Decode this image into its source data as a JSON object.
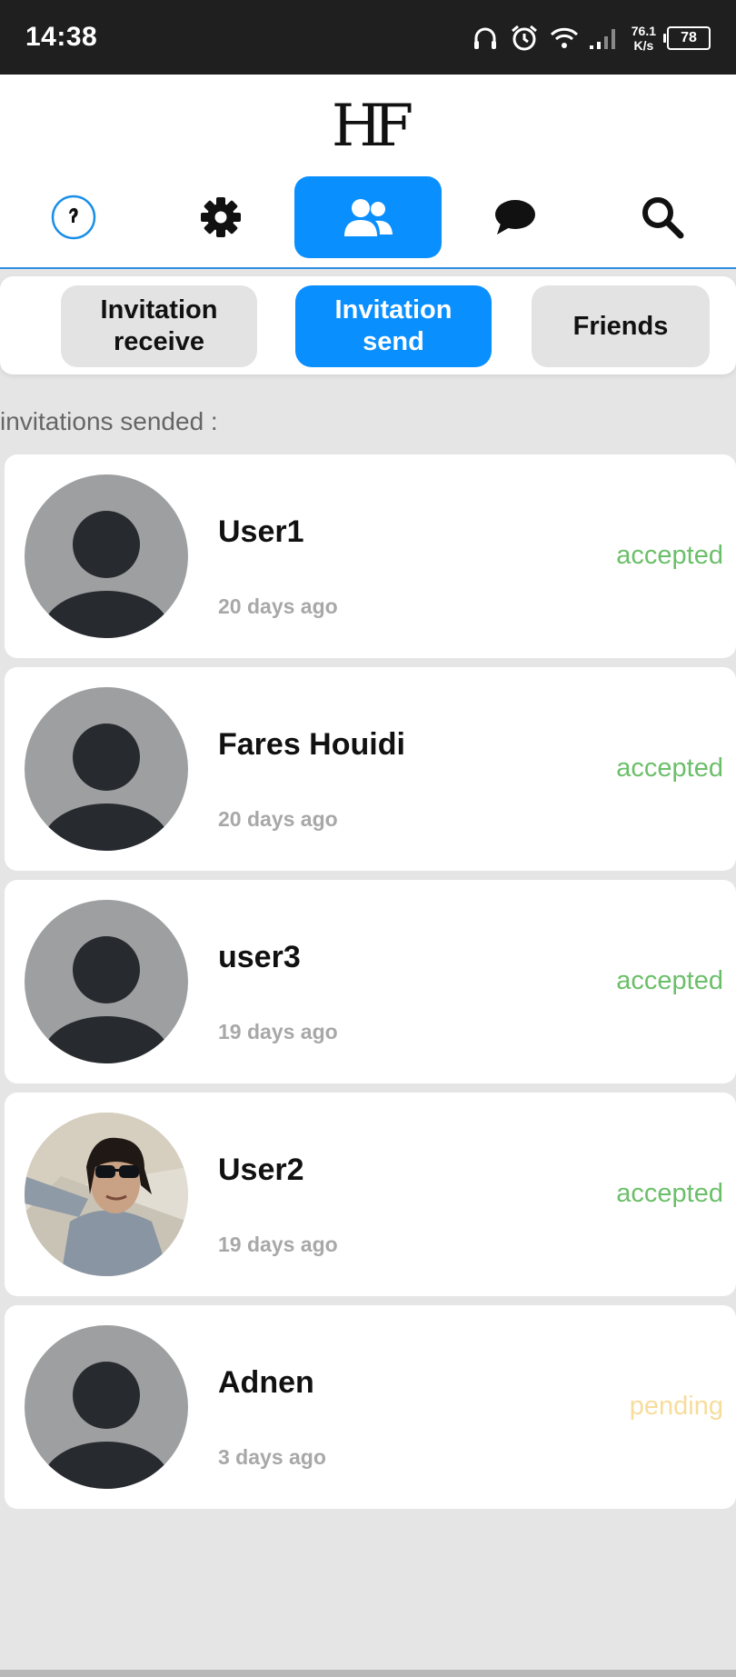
{
  "status_bar": {
    "time": "14:38",
    "net_speed_value": "76.1",
    "net_speed_unit": "K/s",
    "battery": "78"
  },
  "header": {
    "logo": "HF",
    "nav": [
      {
        "name": "profile",
        "icon": "profile-avatar-icon"
      },
      {
        "name": "settings",
        "icon": "gear-icon"
      },
      {
        "name": "friends",
        "icon": "users-icon",
        "active": true
      },
      {
        "name": "messages",
        "icon": "chat-bubble-icon"
      },
      {
        "name": "search",
        "icon": "search-icon"
      }
    ],
    "accent_color": "#0a8fff"
  },
  "tabs": [
    {
      "label": "Invitation\nreceive",
      "active": false
    },
    {
      "label": "Invitation\nsend",
      "active": true
    },
    {
      "label": "Friends",
      "active": false
    }
  ],
  "section_label": "invitations sended :",
  "invitations": [
    {
      "name": "User1",
      "time_ago": "20 days ago",
      "status": "accepted",
      "avatar": "default-avatar"
    },
    {
      "name": "Fares Houidi",
      "time_ago": "20 days ago",
      "status": "accepted",
      "avatar": "default-avatar"
    },
    {
      "name": "user3",
      "time_ago": "19 days ago",
      "status": "accepted",
      "avatar": "default-avatar"
    },
    {
      "name": "User2",
      "time_ago": "19 days ago",
      "status": "accepted",
      "avatar": "photo"
    },
    {
      "name": "Adnen",
      "time_ago": "3 days ago",
      "status": "pending",
      "avatar": "default-avatar"
    }
  ],
  "colors": {
    "accepted": "#6cbf6a",
    "pending": "#f7dd9c"
  }
}
